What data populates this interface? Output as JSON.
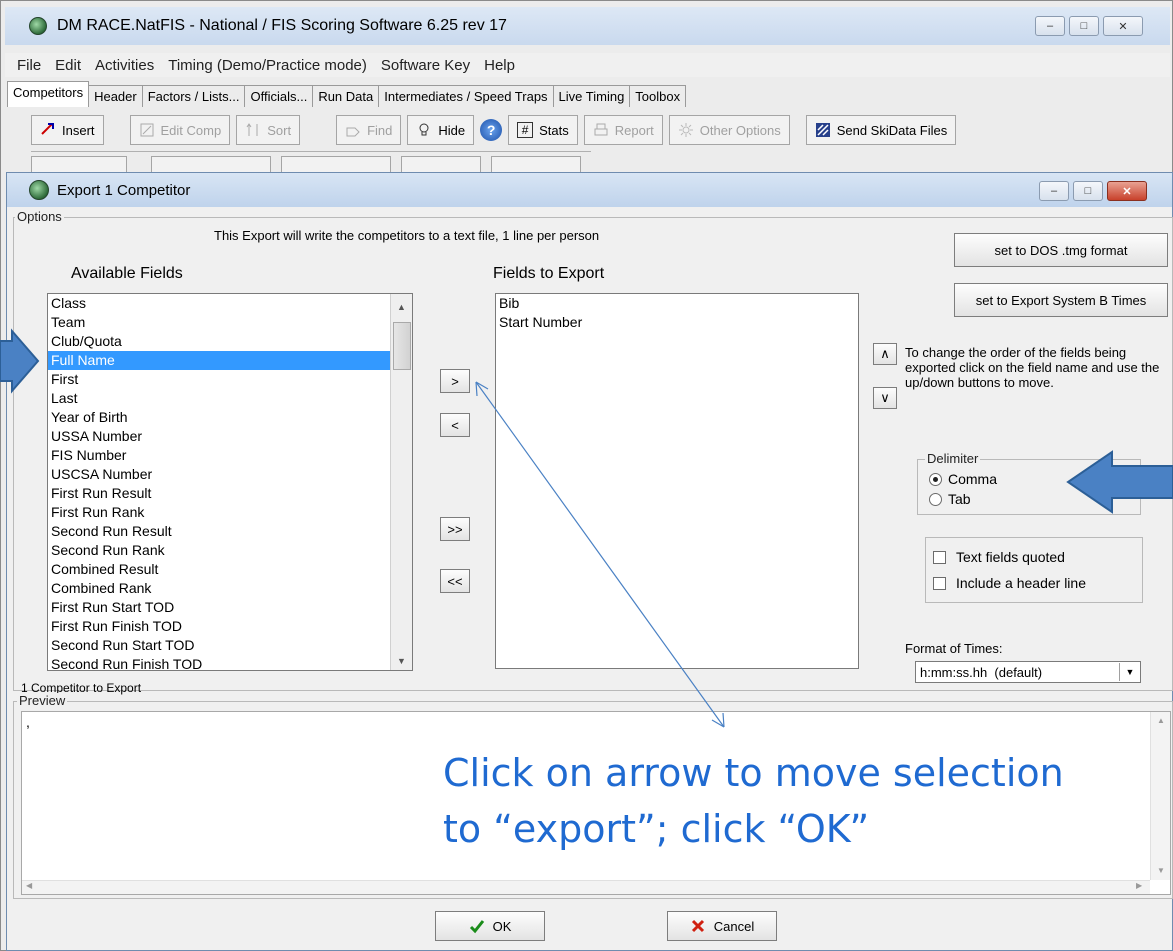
{
  "main_window": {
    "title": "DM RACE.NatFIS - National / FIS Scoring Software 6.25 rev 17",
    "menu": [
      "File",
      "Edit",
      "Activities",
      "Timing (Demo/Practice mode)",
      "Software Key",
      "Help"
    ],
    "tabs": [
      "Competitors",
      "Header",
      "Factors / Lists...",
      "Officials...",
      "Run Data",
      "Intermediates / Speed Traps",
      "Live Timing",
      "Toolbox"
    ],
    "active_tab": "Competitors",
    "toolbar": {
      "insert": "Insert",
      "edit_comp": "Edit Comp",
      "sort": "Sort",
      "find": "Find",
      "hide": "Hide",
      "stats": "Stats",
      "report": "Report",
      "other_options": "Other Options",
      "send_skidata": "Send SkiData Files"
    }
  },
  "dialog": {
    "title": "Export 1 Competitor",
    "options_label": "Options",
    "intro_text": "This Export will write the competitors to a text file, 1 line per person",
    "available_fields_label": "Available Fields",
    "fields_to_export_label": "Fields to Export",
    "available_fields": [
      "Class",
      "Team",
      "Club/Quota",
      "Full Name",
      "First",
      "Last",
      "Year of Birth",
      "USSA Number",
      "FIS Number",
      "USCSA Number",
      "First Run Result",
      "First Run Rank",
      "Second Run Result",
      "Second Run Rank",
      "Combined Result",
      "Combined Rank",
      "First Run Start TOD",
      "First Run Finish TOD",
      "Second Run Start TOD",
      "Second Run Finish TOD"
    ],
    "selected_available": "Full Name",
    "export_fields": [
      "Bib",
      "Start Number"
    ],
    "move_right": ">",
    "move_left": "<",
    "move_all_right": ">>",
    "move_all_left": "<<",
    "dos_button": "set to DOS .tmg format",
    "system_b_button": "set to Export System B Times",
    "order_hint": "To change the order of the fields being exported click on the field name and use the up/down buttons to move.",
    "delimiter_label": "Delimiter",
    "delimiter_options": [
      "Comma",
      "Tab"
    ],
    "delimiter_selected": "Comma",
    "text_fields_quoted": "Text fields quoted",
    "include_header": "Include a header line",
    "format_of_times_label": "Format of Times:",
    "format_of_times_value": "h:mm:ss.hh  (default)",
    "count_label": "1 Competitor to Export",
    "preview_label": "Preview",
    "preview_text": ",",
    "ok": "OK",
    "cancel": "Cancel"
  },
  "annotation": {
    "line1": "Click on arrow to move selection",
    "line2": "to “export”; click “OK”"
  },
  "colors": {
    "selection": "#3399ff",
    "callout_text": "#1f6ad1",
    "callout_arrow": "#4a81c4"
  }
}
